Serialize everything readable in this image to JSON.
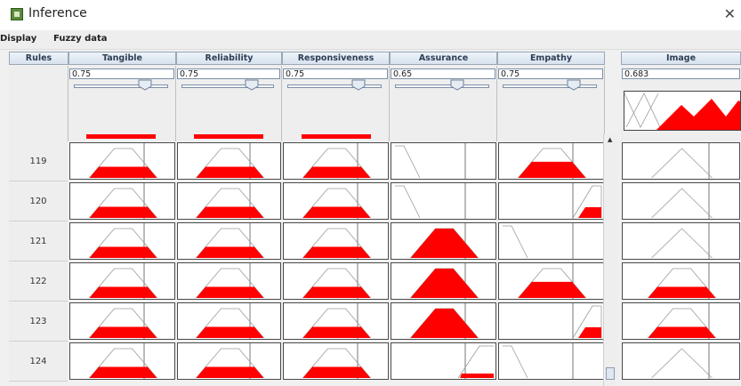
{
  "window": {
    "title": "Inference",
    "close_glyph": "✕",
    "icon": "app-icon"
  },
  "menu": [
    "Display",
    "Fuzzy data"
  ],
  "columns": [
    "Rules",
    "Tangible",
    "Reliability",
    "Responsiveness",
    "Assurance",
    "Empathy",
    "Image"
  ],
  "inputs": [
    {
      "name": "Tangible",
      "value": "0.75",
      "slider": 0.75
    },
    {
      "name": "Reliability",
      "value": "0.75",
      "slider": 0.75
    },
    {
      "name": "Responsiveness",
      "value": "0.75",
      "slider": 0.75
    },
    {
      "name": "Assurance",
      "value": "0.65",
      "slider": 0.65
    },
    {
      "name": "Empathy",
      "value": "0.75",
      "slider": 0.75
    }
  ],
  "output": {
    "name": "Image",
    "value": "0.683"
  },
  "rules": [
    {
      "id": "119",
      "cells": [
        "mid-fill",
        "mid-fill",
        "mid-fill",
        "left-empty",
        "mid-fill-high",
        "mid-empty"
      ]
    },
    {
      "id": "120",
      "cells": [
        "mid-fill",
        "mid-fill",
        "mid-fill",
        "left-empty",
        "right-fill",
        "mid-empty"
      ]
    },
    {
      "id": "121",
      "cells": [
        "mid-fill",
        "mid-fill",
        "mid-fill",
        "mid-fill-full",
        "left-empty",
        "mid-empty"
      ]
    },
    {
      "id": "122",
      "cells": [
        "mid-fill",
        "mid-fill",
        "mid-fill",
        "mid-fill-full",
        "mid-fill-high",
        "mid-fill"
      ]
    },
    {
      "id": "123",
      "cells": [
        "mid-fill",
        "mid-fill",
        "mid-fill",
        "mid-fill-full",
        "right-fill",
        "mid-fill"
      ]
    },
    {
      "id": "124",
      "cells": [
        "mid-fill",
        "mid-fill",
        "mid-fill",
        "right-tiny",
        "left-empty",
        "mid-empty"
      ]
    }
  ],
  "colors": {
    "fill": "#ff0000",
    "outline": "#9a9a9a",
    "header_text": "#2c3e55"
  }
}
